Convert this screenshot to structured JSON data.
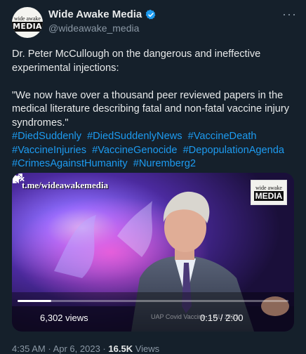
{
  "account": {
    "name": "Wide Awake Media",
    "handle": "@wideawake_media",
    "avatar_small_text": "wide awake",
    "avatar_big_text": "MEDIA",
    "verified_color": "#1d9bf0"
  },
  "more_label": "···",
  "tweet": {
    "text": "Dr. Peter McCullough on the dangerous and ineffective experimental injections:\n\n\"We now have over a thousand peer reviewed papers in the medical literature describing fatal and non-fatal vaccine injury syndromes.\"",
    "hashtags": [
      "#DiedSuddenly",
      "#DiedSuddenlyNews",
      "#VaccineDeath",
      "#VaccineInjuries",
      "#VaccineGenocide",
      "#DepopulationAgenda",
      "#CrimesAgainstHumanity",
      "#Nuremberg2"
    ]
  },
  "video": {
    "watermark_left": "t.me/wideawakemedia",
    "watermark_right_small": "wide awake",
    "watermark_right_big": "MEDIA",
    "caption_text": "UAP Covid Vaccine ... AU 2023",
    "views": "6,302 views",
    "time": "0:15 / 2:00",
    "progress_fraction": 0.125
  },
  "meta": {
    "time": "4:35 AM",
    "separator": "·",
    "date": "Apr 6, 2023",
    "views_count": "16.5K",
    "views_label": "Views"
  }
}
